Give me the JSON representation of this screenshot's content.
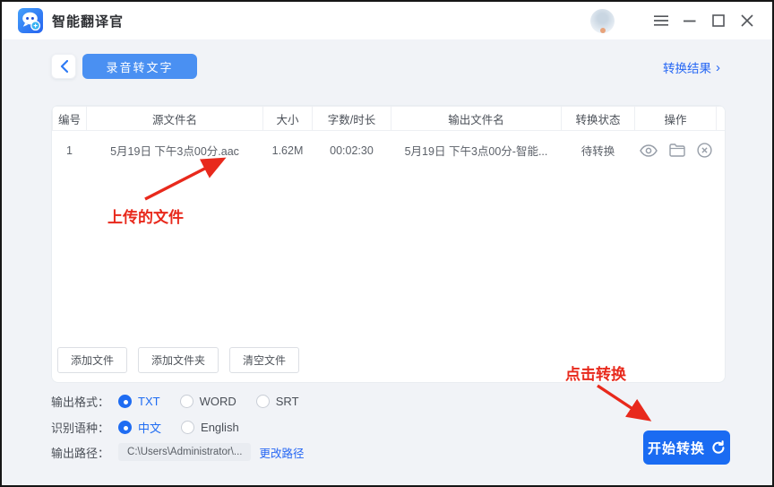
{
  "window": {
    "title": "智能翻译官"
  },
  "toolbar": {
    "tab_label": "录音转文字",
    "results_label": "转换结果"
  },
  "icons": {
    "chevron_right": "›",
    "chevron_left": "‹"
  },
  "table": {
    "headers": [
      "编号",
      "源文件名",
      "大小",
      "字数/时长",
      "输出文件名",
      "转换状态",
      "操作"
    ],
    "rows": [
      {
        "index": "1",
        "source_name": "5月19日 下午3点00分.aac",
        "size": "1.62M",
        "duration": "00:02:30",
        "output_name": "5月19日 下午3点00分-智能...",
        "status": "待转换"
      }
    ]
  },
  "panel_buttons": [
    "添加文件",
    "添加文件夹",
    "清空文件"
  ],
  "annotations": {
    "uploaded_file": "上传的文件",
    "click_convert": "点击转换"
  },
  "settings": {
    "output_format_label": "输出格式：",
    "formats": [
      {
        "label": "TXT",
        "selected": true
      },
      {
        "label": "WORD",
        "selected": false
      },
      {
        "label": "SRT",
        "selected": false
      }
    ],
    "language_label": "识别语种：",
    "languages": [
      {
        "label": "中文",
        "selected": true
      },
      {
        "label": "English",
        "selected": false
      }
    ],
    "output_path_label": "输出路径：",
    "output_path_value": "C:\\Users\\Administrator\\...",
    "change_path_label": "更改路径"
  },
  "convert_button_label": "开始转换",
  "colors": {
    "accent_blue": "#1a6bf2",
    "tab_blue": "#4a90f2",
    "link_blue": "#2667f4",
    "annotation_red": "#e8291c",
    "panel_border": "#e9edf1",
    "background_gray": "#f1f3f7"
  }
}
